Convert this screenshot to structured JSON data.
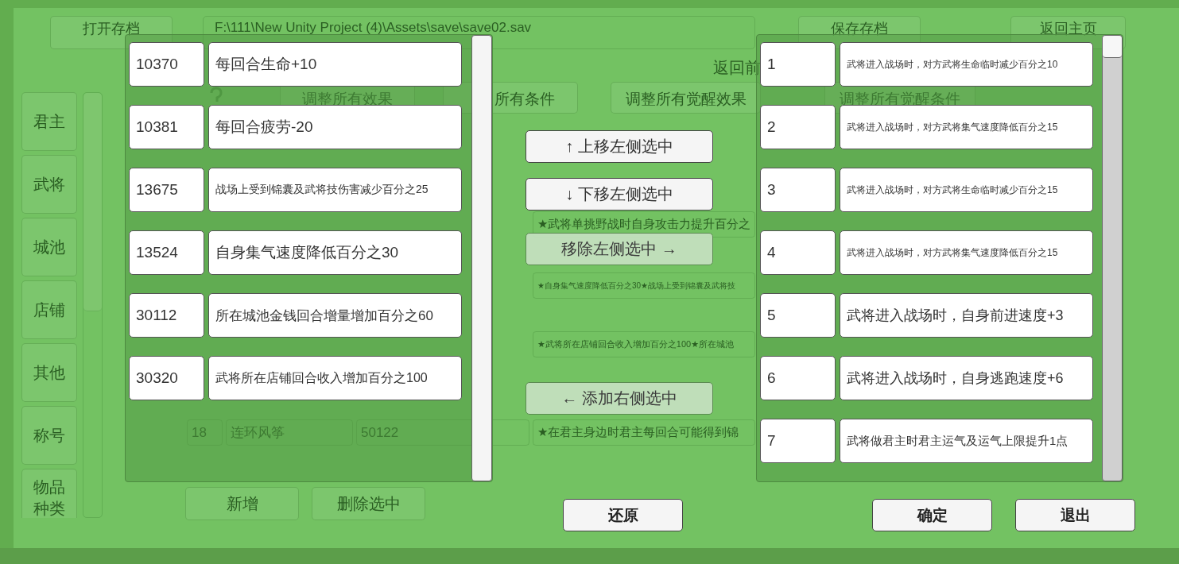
{
  "background": {
    "top_bar": {
      "open_button": "打开存档",
      "path_field": "F:\\111\\New Unity Project (4)\\Assets\\save\\save02.sav",
      "save_button": "保存存档",
      "home_button": "返回主页"
    },
    "back_label": "返回前",
    "tabs": [
      "调整所有效果",
      "所有条件",
      "调整所有觉醒效果",
      "调整所有觉醒条件"
    ],
    "sidebar": {
      "items": [
        "君主",
        "武将",
        "城池",
        "店铺",
        "其他",
        "称号",
        "物品种类"
      ]
    },
    "table": {
      "rows": [
        {
          "effect": "★武将单挑野战时自身攻击力提升百分之"
        },
        {
          "effect": "★自身集气速度降低百分之30★战场上受到锦囊及武将技"
        },
        {
          "effect": "★武将所在店铺回合收入增加百分之100★所在城池"
        },
        {
          "number": "18",
          "name": "连环风筝",
          "ids": "50122",
          "effect": "★在君主身边时君主每回合可能得到锦"
        }
      ]
    },
    "bottom_buttons": [
      "新增",
      "删除选中"
    ]
  },
  "dialog": {
    "left_list": {
      "items": [
        {
          "id": "10370",
          "text": "每回合生命+10"
        },
        {
          "id": "10381",
          "text": "每回合疲劳-20"
        },
        {
          "id": "13675",
          "text": "战场上受到锦囊及武将技伤害减少百分之25"
        },
        {
          "id": "13524",
          "text": "自身集气速度降低百分之30"
        },
        {
          "id": "30112",
          "text": "所在城池金钱回合增量增加百分之60"
        },
        {
          "id": "30320",
          "text": "武将所在店铺回合收入增加百分之100"
        }
      ]
    },
    "actions": [
      {
        "label": "↑ 上移左侧选中",
        "disabled": false
      },
      {
        "label": "↓ 下移左侧选中",
        "disabled": false
      },
      {
        "label": "移除左侧选中 →",
        "disabled": true
      },
      {
        "label": "← 添加右侧选中",
        "disabled": true
      }
    ],
    "right_list": {
      "items": [
        {
          "id": "1",
          "text": "武将进入战场时，对方武将生命临时减少百分之10"
        },
        {
          "id": "2",
          "text": "武将进入战场时，对方武将集气速度降低百分之15"
        },
        {
          "id": "3",
          "text": "武将进入战场时，对方武将生命临时减少百分之15"
        },
        {
          "id": "4",
          "text": "武将进入战场时，对方武将集气速度降低百分之15"
        },
        {
          "id": "5",
          "text": "武将进入战场时，自身前进速度+3"
        },
        {
          "id": "6",
          "text": "武将进入战场时，自身逃跑速度+6"
        },
        {
          "id": "7",
          "text": "武将做君主时君主运气及运气上限提升1点"
        }
      ]
    },
    "buttons": [
      "还原",
      "确定",
      "退出"
    ]
  }
}
